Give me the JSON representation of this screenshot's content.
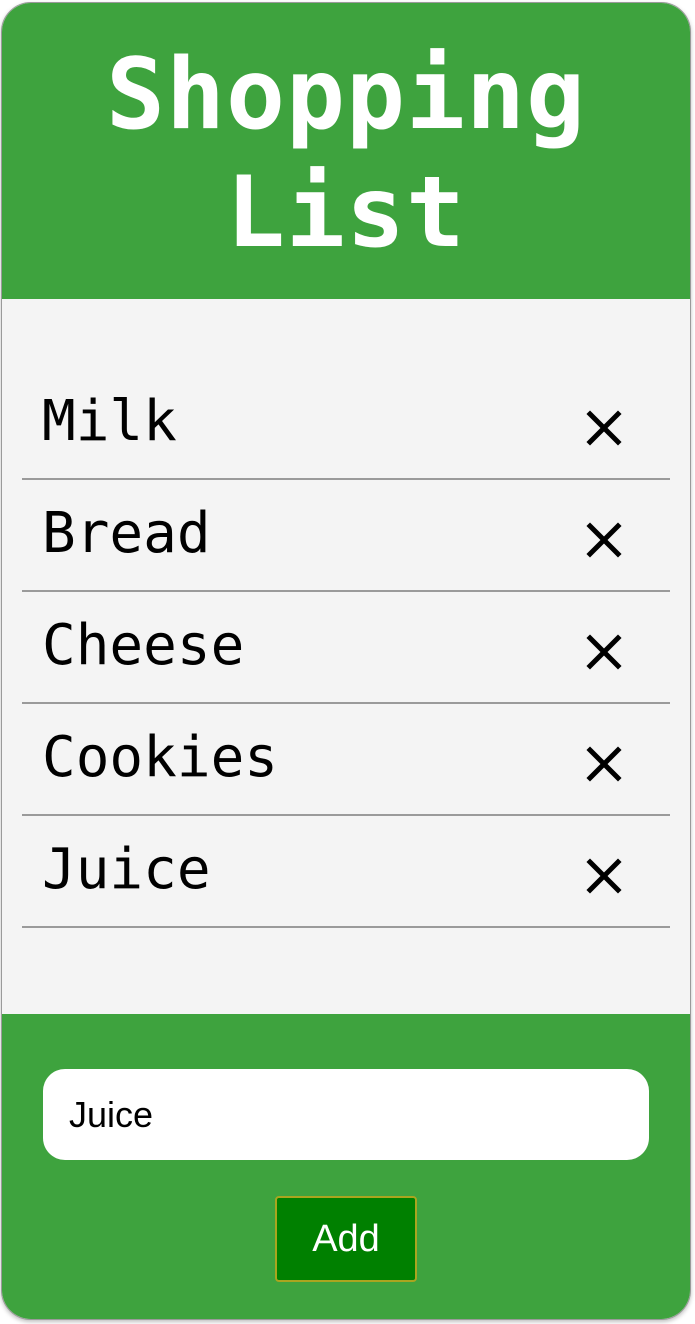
{
  "header": {
    "title": "Shopping List"
  },
  "items": [
    {
      "label": "Milk",
      "remove_icon": "close-icon"
    },
    {
      "label": "Bread",
      "remove_icon": "close-icon"
    },
    {
      "label": "Cheese",
      "remove_icon": "close-icon"
    },
    {
      "label": "Cookies",
      "remove_icon": "close-icon"
    },
    {
      "label": "Juice",
      "remove_icon": "close-icon"
    }
  ],
  "footer": {
    "input_value": "Juice",
    "add_label": "Add"
  },
  "colors": {
    "brand_green": "#3ea33e",
    "button_green": "#008000",
    "list_background": "#f4f4f4"
  }
}
